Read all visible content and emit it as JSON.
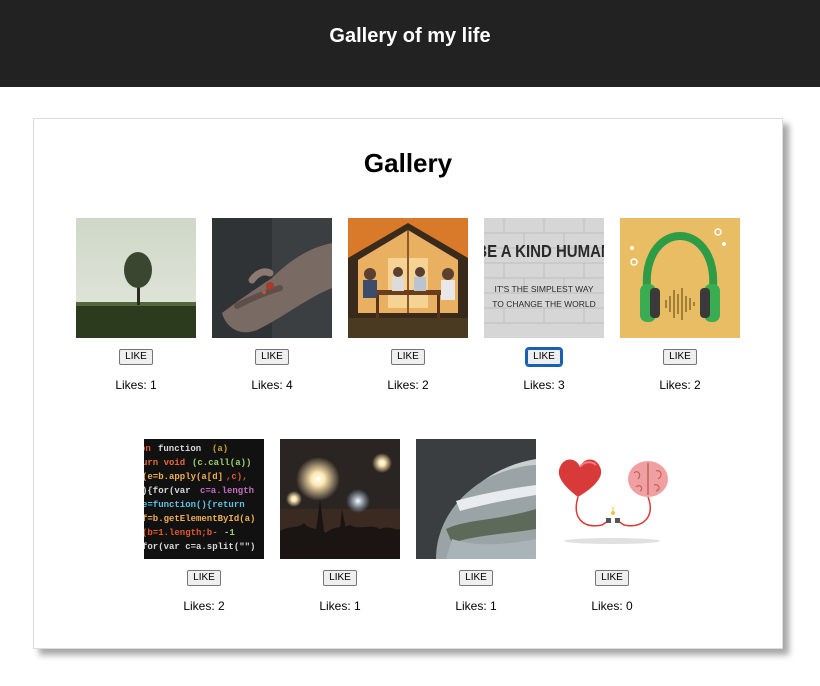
{
  "header": {
    "title": "Gallery of my life"
  },
  "gallery": {
    "title": "Gallery",
    "items": [
      {
        "image": "lone-tree-field",
        "like_label": "LIKE",
        "likes_text": "Likes: 1"
      },
      {
        "image": "hand-holding-object",
        "like_label": "LIKE",
        "likes_text": "Likes: 4"
      },
      {
        "image": "people-dining-outdoors",
        "like_label": "LIKE",
        "likes_text": "Likes: 2"
      },
      {
        "image": "be-a-kind-human-wall",
        "like_label": "LIKE",
        "likes_text": "Likes: 3"
      },
      {
        "image": "headphones-soundwave",
        "like_label": "LIKE",
        "likes_text": "Likes: 2"
      },
      {
        "image": "code-on-screen",
        "like_label": "LIKE",
        "likes_text": "Likes: 2"
      },
      {
        "image": "concert-lights",
        "like_label": "LIKE",
        "likes_text": "Likes: 1"
      },
      {
        "image": "airplane-window-view",
        "like_label": "LIKE",
        "likes_text": "Likes: 1"
      },
      {
        "image": "heart-and-brain",
        "like_label": "LIKE",
        "likes_text": "Likes: 0"
      }
    ],
    "wall_text": [
      "BE A KIND HUMAN",
      "IT'S THE SIMPLEST WAY",
      "TO CHANGE THE WORLD"
    ]
  },
  "colors": {
    "topbar": "#222222",
    "focus": "#1a5fb4"
  }
}
